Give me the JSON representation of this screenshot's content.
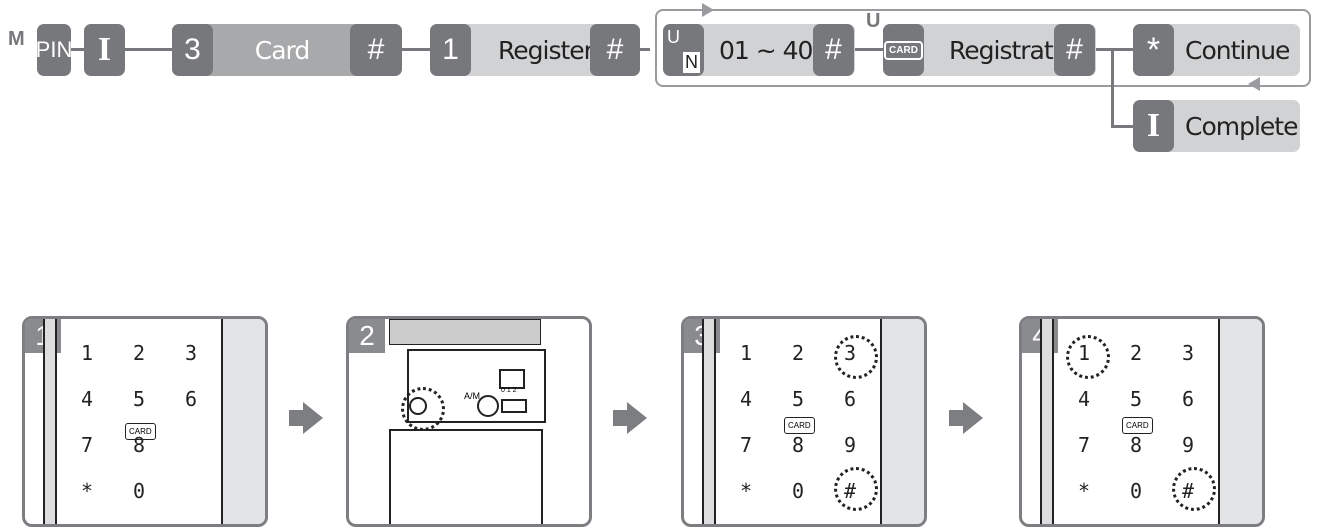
{
  "flow": {
    "mode_label": "M",
    "pin_label": "PIN",
    "i_key": "I",
    "key_3": "3",
    "card_label": "Card",
    "hash": "#",
    "key_1": "1",
    "register_label": "Register",
    "user_key_u": "U",
    "user_key_n": "N",
    "range_label": "01 ~ 40",
    "user_label": "U",
    "card_icon_label": "CARD",
    "registration_label": "Registration",
    "star": "*",
    "continue_label": "Continue",
    "complete_label": "Complete"
  },
  "colors": {
    "key": "#77787b",
    "card_bar": "#a8a9ab",
    "light_bar": "#d1d2d4"
  },
  "steps": [
    {
      "number": "1",
      "keys": [
        "1",
        "2",
        "3",
        "4",
        "5",
        "6",
        "7",
        "8",
        "",
        "*",
        "0",
        ""
      ],
      "card_label": "CARD"
    },
    {
      "number": "2",
      "am_label": "A/M",
      "volume_scale": "0 1 2"
    },
    {
      "number": "3",
      "keys": [
        "1",
        "2",
        "3",
        "4",
        "5",
        "6",
        "7",
        "8",
        "9",
        "*",
        "0",
        "#"
      ],
      "card_label": "CARD"
    },
    {
      "number": "4",
      "keys": [
        "1",
        "2",
        "3",
        "4",
        "5",
        "6",
        "7",
        "8",
        "9",
        "*",
        "0",
        "#"
      ],
      "card_label": "CARD"
    }
  ]
}
